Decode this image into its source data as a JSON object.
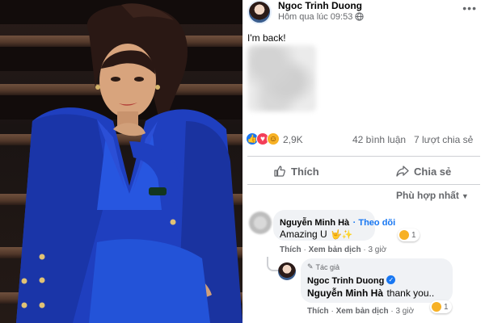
{
  "post": {
    "author_name": "Ngoc Trinh Duong",
    "timestamp": "Hôm qua lúc 09:53",
    "status_text": "I'm back!",
    "reaction_count": "2,9K",
    "comment_count": "42 bình luận",
    "share_count": "7 lượt chia sẻ"
  },
  "actions": {
    "like_label": "Thích",
    "share_label": "Chia sẻ"
  },
  "sort_label": "Phù hợp nhất",
  "comments": [
    {
      "author": "Nguyễn Minh Hà",
      "follow_label": "Theo dõi",
      "text": "Amazing U",
      "reaction_count": "1",
      "like_label": "Thích",
      "translate_label": "Xem bản dịch",
      "time": "3 giờ"
    }
  ],
  "reply": {
    "author_tag": "Tác giả",
    "author": "Ngoc Trinh Duong",
    "mention": "Nguyễn Minh Hà",
    "text": "thank you..",
    "reaction_count": "1",
    "like_label": "Thích",
    "translate_label": "Xem bản dịch",
    "time": "3 giờ"
  },
  "icons": [
    "globe-icon",
    "more-icon",
    "like-reaction-icon",
    "love-reaction-icon",
    "haha-reaction-icon",
    "thumbs-up-icon",
    "share-arrow-icon",
    "caret-down-icon",
    "verified-icon",
    "pencil-icon"
  ],
  "colors": {
    "accent": "#1877f2",
    "secondary_text": "#65676b",
    "bubble": "#f0f2f5",
    "love": "#f33e58",
    "haha": "#f7b125"
  }
}
